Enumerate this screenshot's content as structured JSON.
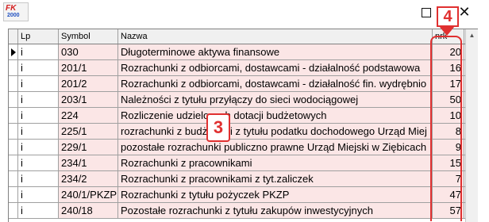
{
  "window": {
    "logo_text": "FK",
    "logo_year": "2000",
    "maximize_icon": "maximize-icon",
    "close_label": "✕"
  },
  "grid": {
    "columns": [
      "Lp",
      "Symbol",
      "Nazwa",
      "nrk"
    ],
    "rows": [
      {
        "lp": "i",
        "symbol": "030",
        "nazwa": "Długoterminowe aktywa finansowe",
        "nrk": "20",
        "selected": true
      },
      {
        "lp": "i",
        "symbol": "201/1",
        "nazwa": "Rozrachunki z odbiorcami, dostawcami - działalność podstawowa",
        "nrk": "16"
      },
      {
        "lp": "i",
        "symbol": "201/2",
        "nazwa": "Rozrachunki z odbiorcami, dostawcami - działalność fin. wydrębnio",
        "nrk": "17"
      },
      {
        "lp": "i",
        "symbol": "203/1",
        "nazwa": "Należności z tytułu przyłączy do sieci wodociągowej",
        "nrk": "50"
      },
      {
        "lp": "i",
        "symbol": "224",
        "nazwa": "Rozliczenie udzielonych dotacji budżetowych",
        "nrk": "10"
      },
      {
        "lp": "i",
        "symbol": "225/1",
        "nazwa": "rozrachunki z budżetami z tytułu podatku dochodowego Urząd Miej",
        "nrk": "8"
      },
      {
        "lp": "i",
        "symbol": "229/1",
        "nazwa": "pozostałe rozrachunki publiczno prawne Urząd Miejski w Ziębicach",
        "nrk": "9"
      },
      {
        "lp": "i",
        "symbol": "234/1",
        "nazwa": "Rozrachunki z pracownikami",
        "nrk": "15"
      },
      {
        "lp": "i",
        "symbol": "234/2",
        "nazwa": "Rozrachunki z pracownikami z tyt.zaliczek",
        "nrk": "7"
      },
      {
        "lp": "i",
        "symbol": "240/1/PKZP",
        "nazwa": "Rozrachunki z tytułu pożyczek PKZP",
        "nrk": "47"
      },
      {
        "lp": "i",
        "symbol": "240/18",
        "nazwa": "Pozostałe rozrachunki z tytułu zakupów inwestycyjnych",
        "nrk": "57"
      }
    ]
  },
  "annotations": {
    "badge_3": "3",
    "badge_4": "4"
  },
  "colors": {
    "highlight_row": "#fbe6e6",
    "annotation_red": "#e03030"
  }
}
